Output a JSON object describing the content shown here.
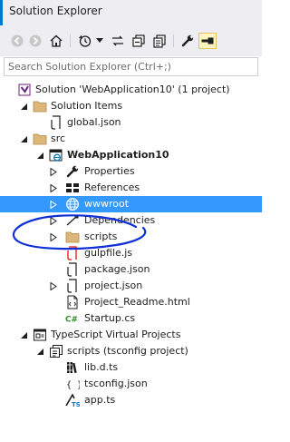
{
  "window": {
    "title": "Solution Explorer"
  },
  "search": {
    "placeholder": "Search Solution Explorer (Ctrl+;)"
  },
  "toolbar": {
    "buttons": [
      "back-icon",
      "forward-icon",
      "home-icon",
      "history-icon",
      "dropdown-icon",
      "sync-icon",
      "collapse-all-icon",
      "show-all-files-icon",
      "properties-wrench-icon",
      "preview-pin-icon"
    ]
  },
  "tree": {
    "solution": {
      "label": "Solution 'WebApplication10' (1 project)"
    },
    "solution_items": {
      "label": "Solution Items"
    },
    "global_json": {
      "label": "global.json"
    },
    "src": {
      "label": "src"
    },
    "webapp": {
      "label": "WebApplication10"
    },
    "properties": {
      "label": "Properties"
    },
    "references": {
      "label": "References"
    },
    "wwwroot": {
      "label": "wwwroot"
    },
    "dependencies": {
      "label": "Dependencies"
    },
    "scripts": {
      "label": "scripts"
    },
    "gulpfile": {
      "label": "gulpfile.js"
    },
    "package_json": {
      "label": "package.json"
    },
    "project_json": {
      "label": "project.json"
    },
    "readme": {
      "label": "Project_Readme.html"
    },
    "startup": {
      "label": "Startup.cs"
    },
    "ts_virtual": {
      "label": "TypeScript Virtual Projects"
    },
    "ts_scripts": {
      "label": "scripts (tsconfig project)"
    },
    "lib_dts": {
      "label": "lib.d.ts"
    },
    "tsconfig": {
      "label": "tsconfig.json"
    },
    "app_ts": {
      "label": "app.ts"
    }
  },
  "colors": {
    "accent": "#007acc",
    "selection": "#3399ff",
    "annotation_ink": "#0f2fd6",
    "folder": "#dcb67a"
  }
}
